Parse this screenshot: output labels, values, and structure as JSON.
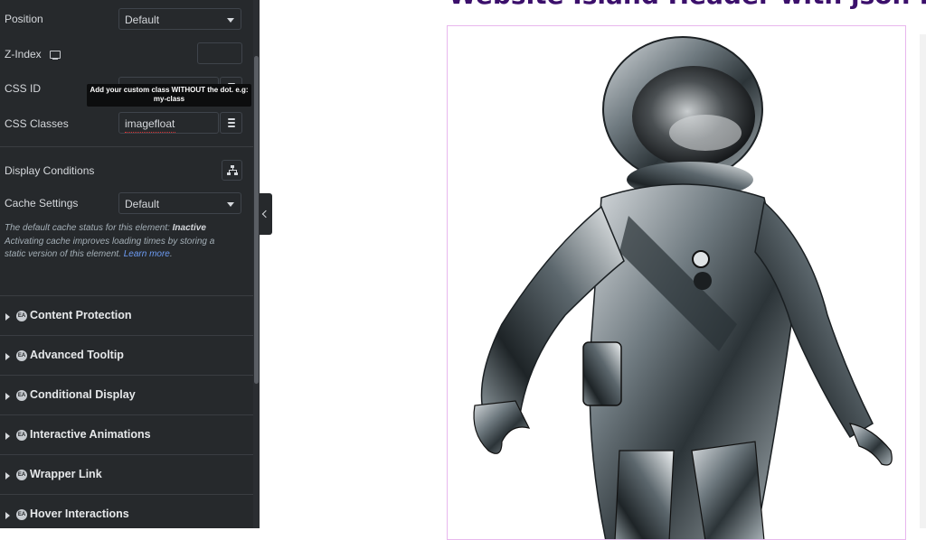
{
  "panel": {
    "position": {
      "label": "Position",
      "value": "Default"
    },
    "zindex": {
      "label": "Z-Index",
      "value": ""
    },
    "cssid": {
      "label": "CSS ID",
      "value": ""
    },
    "tooltip": "Add your custom class WITHOUT the dot. e.g: my-class",
    "cssclasses": {
      "label": "CSS Classes",
      "value": "imagefloat"
    },
    "display_conditions": {
      "label": "Display Conditions"
    },
    "cache": {
      "label": "Cache Settings",
      "value": "Default"
    },
    "help": {
      "line1_prefix": "The default cache status for this element: ",
      "line1_status": "Inactive",
      "line2": "Activating cache improves loading times by storing a static version of this element. ",
      "link": "Learn more",
      "suffix": "."
    },
    "sections": [
      {
        "label": "Content Protection",
        "badge": "EA"
      },
      {
        "label": "Advanced Tooltip",
        "badge": "EA"
      },
      {
        "label": "Conditional Display",
        "badge": "EA"
      },
      {
        "label": "Interactive Animations",
        "badge": "EA"
      },
      {
        "label": "Wrapper Link",
        "badge": "EA"
      },
      {
        "label": "Hover Interactions",
        "badge": "EA"
      }
    ]
  },
  "canvas": {
    "heading": "Website Island Header with json file"
  },
  "colors": {
    "panel_bg": "#26292c",
    "heading": "#3b0f6b",
    "frame_border": "#e8b7ee",
    "link": "#6d9cf5"
  }
}
